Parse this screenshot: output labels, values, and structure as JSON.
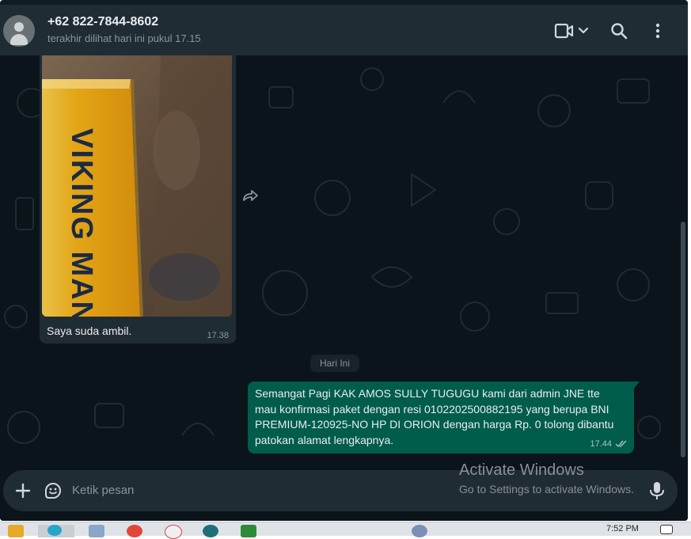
{
  "header": {
    "contact_name": "+62 822-7844-8602",
    "status": "terakhir dilihat hari ini pukul 17.15",
    "icons": [
      "video-call-icon",
      "chevron-down-icon",
      "search-icon",
      "menu-icon"
    ]
  },
  "messages": {
    "incoming": {
      "image_text": "VIKING MAN",
      "caption": "Saya suda ambil.",
      "time": "17.38"
    },
    "day_separator": "Hari Ini",
    "outgoing": {
      "text": "Semangat Pagi KAK AMOS SULLY TUGUGU kami dari admin JNE tte mau konfirmasi paket dengan resi 0102202500882195 yang berupa BNI PREMIUM-120925-NO HP DI ORION dengan harga Rp. 0 tolong dibantu patokan alamat lengkapnya.",
      "time": "17.44",
      "status": "read"
    }
  },
  "composer": {
    "placeholder": "Ketik pesan"
  },
  "watermark": {
    "title": "Activate Windows",
    "subtitle": "Go to Settings to activate Windows."
  },
  "taskbar": {
    "time": "7:52 PM"
  },
  "colors": {
    "header_bg": "#202c33",
    "chat_bg": "#0b141a",
    "incoming_bubble": "#202c33",
    "outgoing_bubble": "#005c4b"
  }
}
